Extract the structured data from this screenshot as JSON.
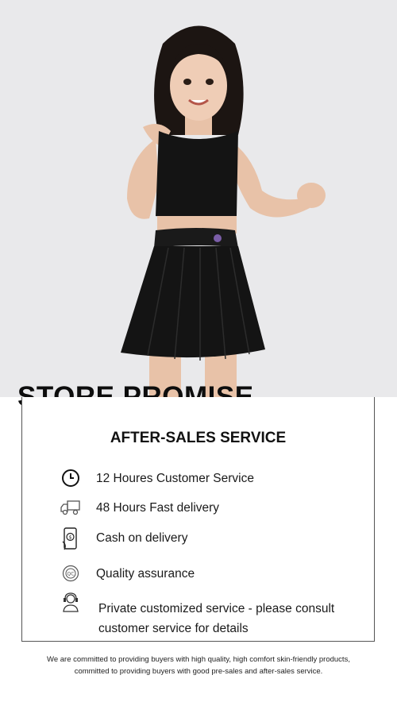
{
  "store_title": "STORE PROMISE",
  "after_sales_title": "AFTER-SALES SERVICE",
  "services": [
    {
      "label": "12 Houres Customer Service",
      "icon": "clock-icon"
    },
    {
      "label": "48 Hours Fast delivery",
      "icon": "delivery-truck-icon"
    },
    {
      "label": "Cash on delivery",
      "icon": "cash-on-delivery-phone-icon"
    },
    {
      "label": "Quality assurance",
      "icon": "quality-badge-icon"
    },
    {
      "label_line1": "Private customized service - please consult",
      "label_line2": "customer service for details",
      "icon": "customer-service-agent-icon"
    }
  ],
  "footer": {
    "line1": "We are committed to providing buyers with high quality, high comfort skin-friendly products,",
    "line2": "committed to providing buyers with good pre-sales and after-sales service."
  },
  "colors": {
    "hero_background": "#e9e9eb",
    "garment": "#141414",
    "text": "#111111"
  }
}
